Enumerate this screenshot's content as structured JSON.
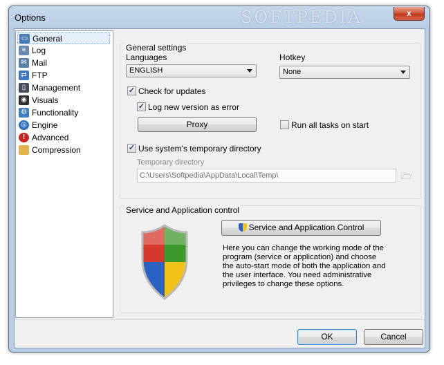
{
  "window": {
    "title": "Options",
    "watermark": "SOFTPEDIA",
    "close_label": "x"
  },
  "sidebar": {
    "items": [
      {
        "label": "General",
        "icon": "window-icon",
        "color": "#4a79b5",
        "selected": true
      },
      {
        "label": "Log",
        "icon": "log-icon",
        "color": "#6a8bb0"
      },
      {
        "label": "Mail",
        "icon": "mail-icon",
        "color": "#5b7fa5"
      },
      {
        "label": "FTP",
        "icon": "ftp-icon",
        "color": "#3d78c4"
      },
      {
        "label": "Management",
        "icon": "management-icon",
        "color": "#444c57"
      },
      {
        "label": "Visuals",
        "icon": "camera-icon",
        "color": "#2f2f2f"
      },
      {
        "label": "Functionality",
        "icon": "functionality-icon",
        "color": "#3a7fc8"
      },
      {
        "label": "Engine",
        "icon": "engine-icon",
        "color": "#2f6fc0"
      },
      {
        "label": "Advanced",
        "icon": "warning-icon",
        "color": "#cc2222"
      },
      {
        "label": "Compression",
        "icon": "folder-icon",
        "color": "#e1b34a"
      }
    ]
  },
  "general": {
    "group_title": "General settings",
    "languages_label": "Languages",
    "languages_value": "ENGLISH",
    "hotkey_label": "Hotkey",
    "hotkey_value": "None",
    "check_updates_label": "Check for updates",
    "check_updates_checked": true,
    "log_version_label": "Log new version as error",
    "log_version_checked": true,
    "proxy_label": "Proxy",
    "run_all_label": "Run all tasks on start",
    "run_all_checked": false,
    "temp_dir_label": "Use system's temporary directory",
    "temp_dir_checked": true,
    "temp_dir_field_label": "Temporary directory",
    "temp_dir_value": "C:\\Users\\Softpedia\\AppData\\Local\\Temp\\"
  },
  "service": {
    "group_title": "Service and Application control",
    "button_label": "Service and Application Control",
    "description": "Here you can change the working mode of the program (service or application) and choose the auto-start mode of both the application and the user interface. You need administrative privileges to change these options."
  },
  "footer": {
    "ok_label": "OK",
    "cancel_label": "Cancel"
  }
}
